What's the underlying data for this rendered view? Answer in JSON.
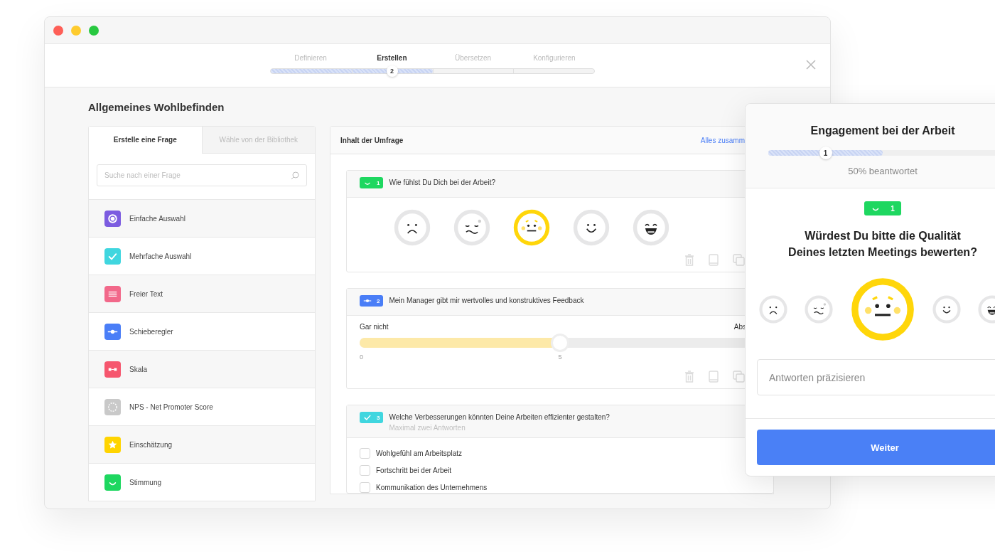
{
  "stepper": {
    "steps": [
      {
        "label": "Definieren",
        "selected": false
      },
      {
        "label": "Erstellen",
        "selected": true
      },
      {
        "label": "Übersetzen",
        "selected": false
      },
      {
        "label": "Konfigurieren",
        "selected": false
      }
    ],
    "level": 0.5,
    "marker": "2"
  },
  "title": "Allgemeines Wohlbefinden",
  "question_types": {
    "tabs": [
      {
        "label": "Erstelle eine Frage",
        "selected": true
      },
      {
        "label": "Wähle von der Bibliothek",
        "selected": false
      }
    ],
    "search": {
      "placeholder": "Suche nach einer Frage"
    },
    "items": [
      {
        "kind": "single",
        "color": "#7c5ce0",
        "label": "Einfache Auswahl"
      },
      {
        "kind": "multiple",
        "color": "#40d6df",
        "label": "Mehrfache Auswahl"
      },
      {
        "kind": "text",
        "color": "#f2688a",
        "label": "Freier Text"
      },
      {
        "kind": "slider",
        "color": "#4a7ef7",
        "label": "Schieberegler"
      },
      {
        "kind": "scale",
        "color": "#f6566e",
        "label": "Skala"
      },
      {
        "kind": "nps",
        "color": "#c9c9c9",
        "label": "NPS - Net Promoter Score"
      },
      {
        "kind": "rating",
        "color": "#ffd400",
        "label": "Einschätzung"
      },
      {
        "kind": "mood",
        "color": "#1ed760",
        "label": "Stimmung"
      }
    ]
  },
  "survey": {
    "title": "Inhalt der Umfrage",
    "link": "Alles zusamm",
    "questions": [
      {
        "kind": "mood",
        "number": "1",
        "color": "#1ed760",
        "text": "Wie fühlst Du Dich bei der Arbeit?",
        "faces": [
          {
            "kind": "sad",
            "selected": false
          },
          {
            "kind": "worried",
            "selected": false
          },
          {
            "kind": "neutral",
            "selected": true
          },
          {
            "kind": "happy",
            "selected": false
          },
          {
            "kind": "laughing",
            "selected": false
          }
        ]
      },
      {
        "kind": "slider",
        "number": "2",
        "color": "#4a7ef7",
        "text": "Mein Manager gibt mir wertvolles und konstruktives Feedback",
        "min_label": "Gar nicht",
        "max_label": "Abs",
        "level": 0.5,
        "ticks": [
          "0",
          "5"
        ]
      },
      {
        "kind": "multiple",
        "number": "3",
        "color": "#40d6df",
        "text": "Welche Verbesserungen könnten Deine Arbeiten effizienter gestalten?",
        "hint": "Maximal zwei Antworten",
        "options": [
          {
            "label": "Wohlgefühl am Arbeitsplatz",
            "checked": false
          },
          {
            "label": "Fortschritt bei der Arbeit",
            "checked": false
          },
          {
            "label": "Kommunikation des Unternehmens",
            "checked": false
          }
        ]
      }
    ]
  },
  "preview": {
    "title": "Engagement bei der Arbeit",
    "level": 0.5,
    "marker": "1",
    "progress_text": "50% beantwortet",
    "badge": {
      "kind": "mood",
      "number": "1",
      "color": "#1ed760"
    },
    "question": "Würdest Du bitte die Qualität\nDeines letzten Meetings bewerten?",
    "faces": [
      {
        "kind": "sad",
        "selected": false
      },
      {
        "kind": "worried",
        "selected": false
      },
      {
        "kind": "neutral",
        "selected": true
      },
      {
        "kind": "happy",
        "selected": false
      },
      {
        "kind": "laughing",
        "selected": false
      }
    ],
    "comment": {
      "placeholder": "Antworten präzisieren"
    },
    "button": "Weiter"
  }
}
